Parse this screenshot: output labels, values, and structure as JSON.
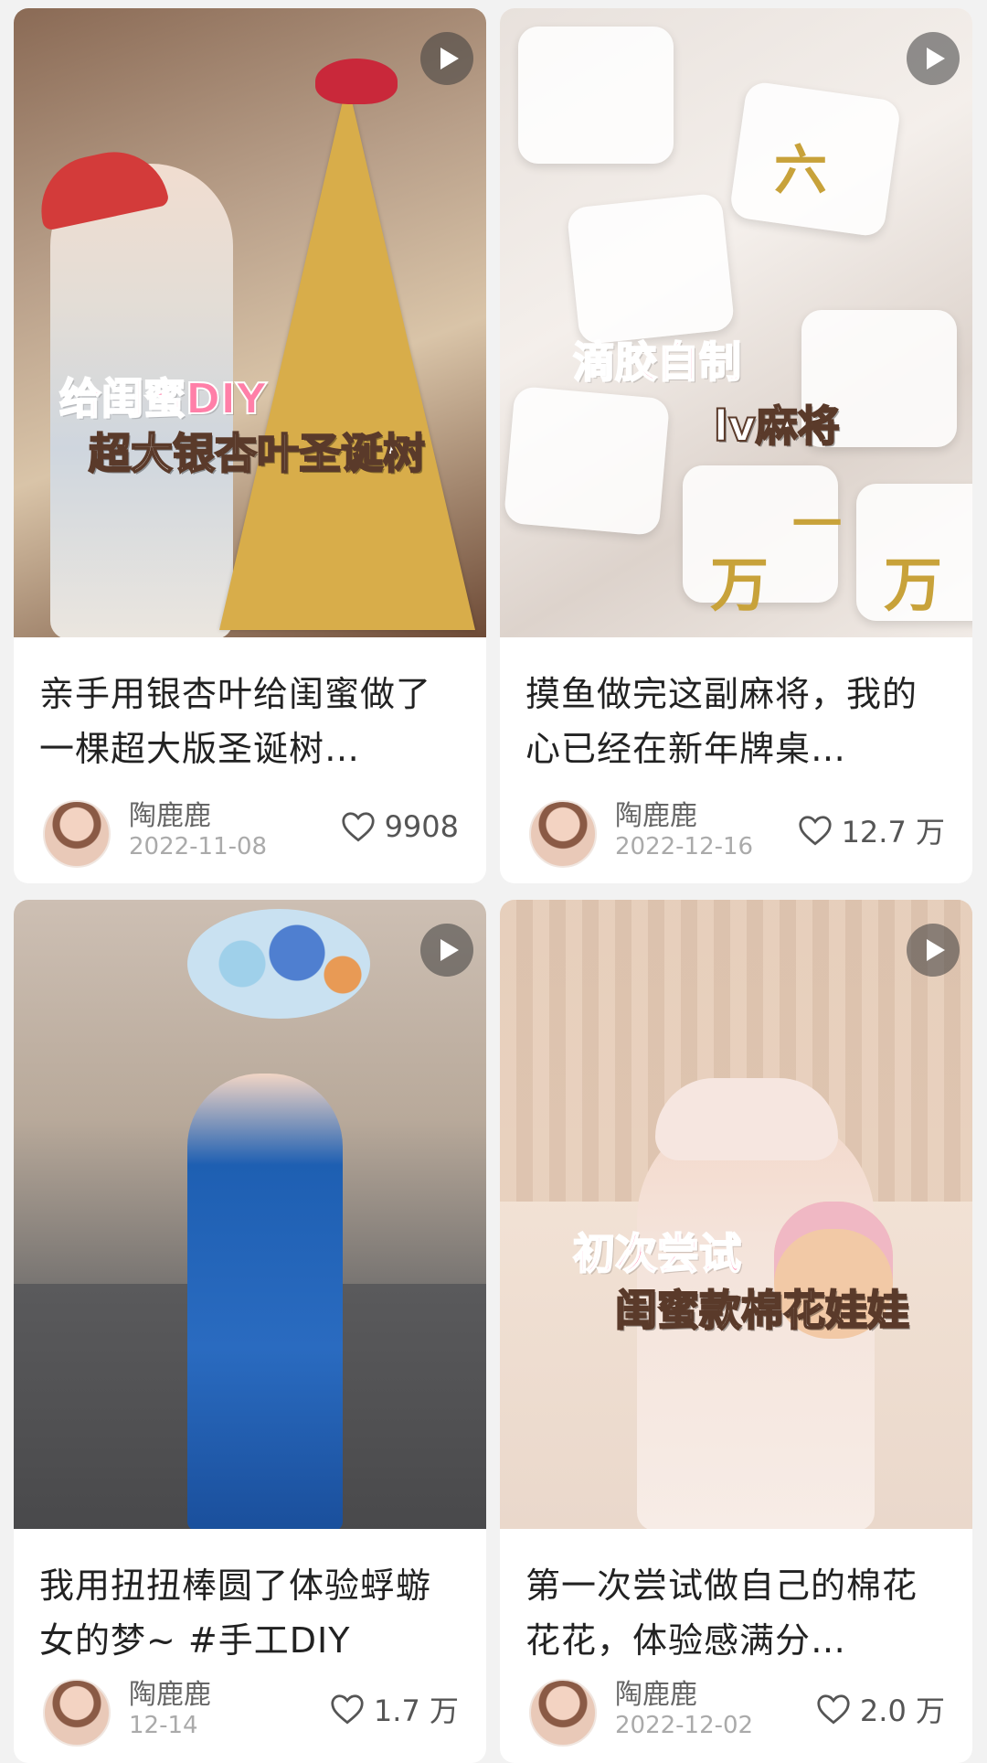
{
  "cards": [
    {
      "overlay_line1": "给闺蜜DIY",
      "overlay_line2": "超大银杏叶圣诞树",
      "title": "亲手用银杏叶给闺蜜做了一棵超大版圣诞树…",
      "author": "陶鹿鹿",
      "date": "2022-11-08",
      "likes": "9908",
      "is_video": true
    },
    {
      "overlay_line1": "滴胶自制",
      "overlay_line2": "lv麻将",
      "title": "摸鱼做完这副麻将，我的心已经在新年牌桌…",
      "author": "陶鹿鹿",
      "date": "2022-12-16",
      "likes": "12.7 万",
      "is_video": true
    },
    {
      "overlay_line1": "",
      "overlay_line2": "",
      "title": "我用扭扭棒圆了体验蜉蝣女的梦~ #手工DIY",
      "author": "陶鹿鹿",
      "date": "12-14",
      "likes": "1.7 万",
      "is_video": true
    },
    {
      "overlay_line1": "初次尝试",
      "overlay_line2": "闺蜜款棉花娃娃",
      "title": "第一次尝试做自己的棉花花花，体验感满分…",
      "author": "陶鹿鹿",
      "date": "2022-12-02",
      "likes": "2.0 万",
      "is_video": true
    }
  ],
  "icons": {
    "play": "play-icon",
    "like": "heart-icon"
  },
  "colors": {
    "overlay_pink": "#ff7fa8",
    "mahjong_gold": "#c8a23a",
    "page_bg": "#f2f2f2"
  },
  "mahjong_glyphs": [
    "万",
    "一",
    "六"
  ]
}
